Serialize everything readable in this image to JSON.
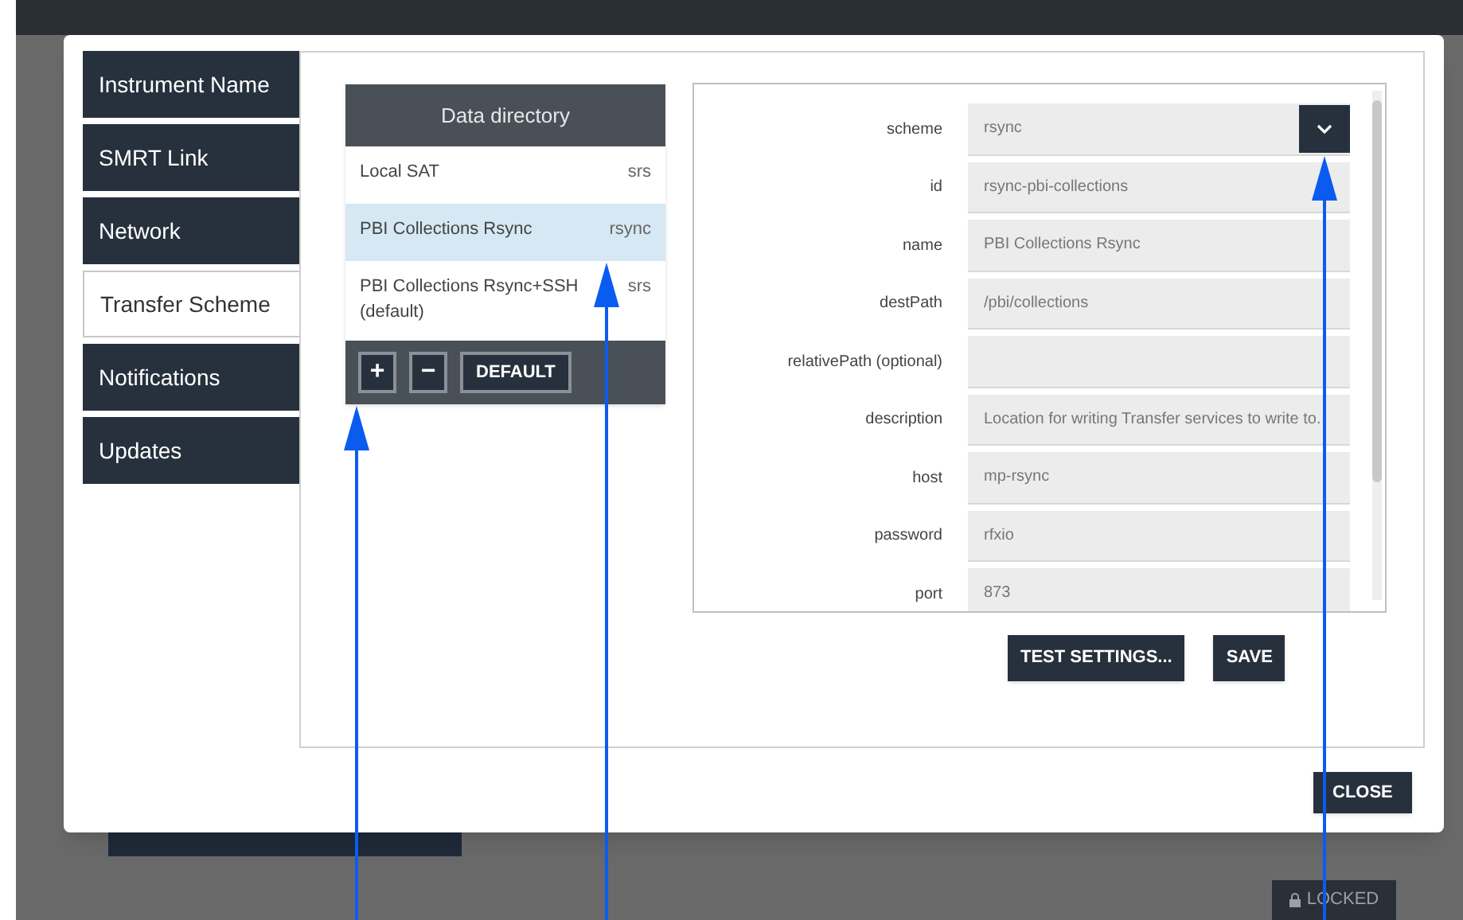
{
  "tabs": [
    {
      "label": "Instrument Name",
      "selected": false
    },
    {
      "label": "SMRT Link",
      "selected": false
    },
    {
      "label": "Network",
      "selected": false
    },
    {
      "label": "Transfer Scheme",
      "selected": true
    },
    {
      "label": "Notifications",
      "selected": false
    },
    {
      "label": "Updates",
      "selected": false
    }
  ],
  "directory": {
    "title": "Data directory",
    "items": [
      {
        "name": "Local SAT",
        "scheme": "srs",
        "selected": false
      },
      {
        "name": "PBI Collections Rsync",
        "scheme": "rsync",
        "selected": true
      },
      {
        "name": "PBI Collections Rsync+SSH (default)",
        "scheme": "srs",
        "selected": false
      }
    ],
    "buttons": [
      "+",
      "−",
      "DEFAULT"
    ]
  },
  "form": {
    "fields": [
      {
        "label": "scheme",
        "value": "rsync",
        "kind": "select"
      },
      {
        "label": "id",
        "value": "rsync-pbi-collections",
        "kind": "text"
      },
      {
        "label": "name",
        "value": "PBI Collections Rsync",
        "kind": "text"
      },
      {
        "label": "destPath",
        "value": "/pbi/collections",
        "kind": "text"
      },
      {
        "label": "relativePath (optional)",
        "kind": "text"
      },
      {
        "label": "description",
        "value": "Location for writing Transfer services to write to.",
        "kind": "text"
      },
      {
        "label": "host",
        "value": "mp-rsync",
        "kind": "text"
      },
      {
        "label": "password",
        "value": "rfxio",
        "kind": "text"
      },
      {
        "label": "port",
        "value": "873",
        "kind": "text"
      }
    ],
    "buttons": [
      "TEST SETTINGS...",
      "SAVE"
    ]
  },
  "close_button": "CLOSE",
  "background": {
    "lock_button": "LOCKED"
  }
}
